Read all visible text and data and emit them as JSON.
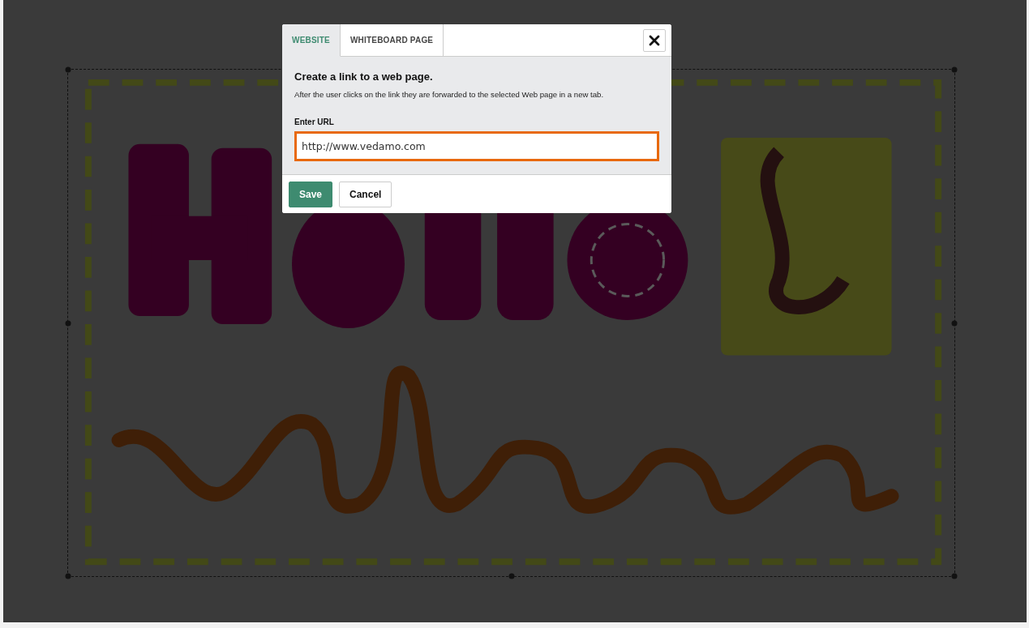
{
  "canvas": {
    "image": {
      "kind": "picture",
      "selected": true
    }
  },
  "tabs": [
    {
      "label": "WEBSITE",
      "selected": true
    },
    {
      "label": "WHITEBOARD PAGE",
      "selected": false
    }
  ],
  "dialog": {
    "title": "Create a link to a web page.",
    "description": "After the user clicks on the link they are forwarded to the selected Web page in a new tab.",
    "url_label": "Enter URL",
    "url_field": {
      "value": "http://www.vedamo.com",
      "focused": true
    }
  },
  "buttons": [
    {
      "label": "Save",
      "kind": "primary"
    },
    {
      "label": "Cancel",
      "kind": "secondary"
    }
  ]
}
